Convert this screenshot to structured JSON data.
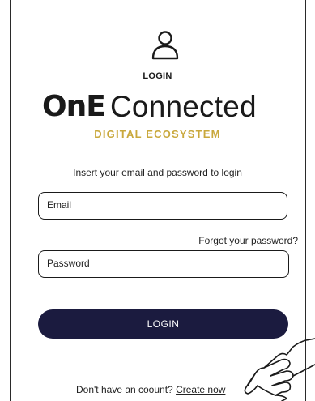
{
  "header": {
    "title": "LOGIN"
  },
  "logo": {
    "part1": "OnE",
    "part2": "Connected"
  },
  "tagline": "DIGITAL ECOSYSTEM",
  "instruction": "Insert your email and password to login",
  "email": {
    "placeholder": "Email"
  },
  "forgot_link": "Forgot your password?",
  "password": {
    "placeholder": "Password"
  },
  "login_button": "LOGIN",
  "signup": {
    "prompt": "Don't have an coount?",
    "link": "Create now"
  },
  "colors": {
    "accent_gold": "#c9a83c",
    "button_navy": "#1b1b3f"
  },
  "icons": {
    "user": "user-icon",
    "hand": "pointing-hand-icon"
  }
}
